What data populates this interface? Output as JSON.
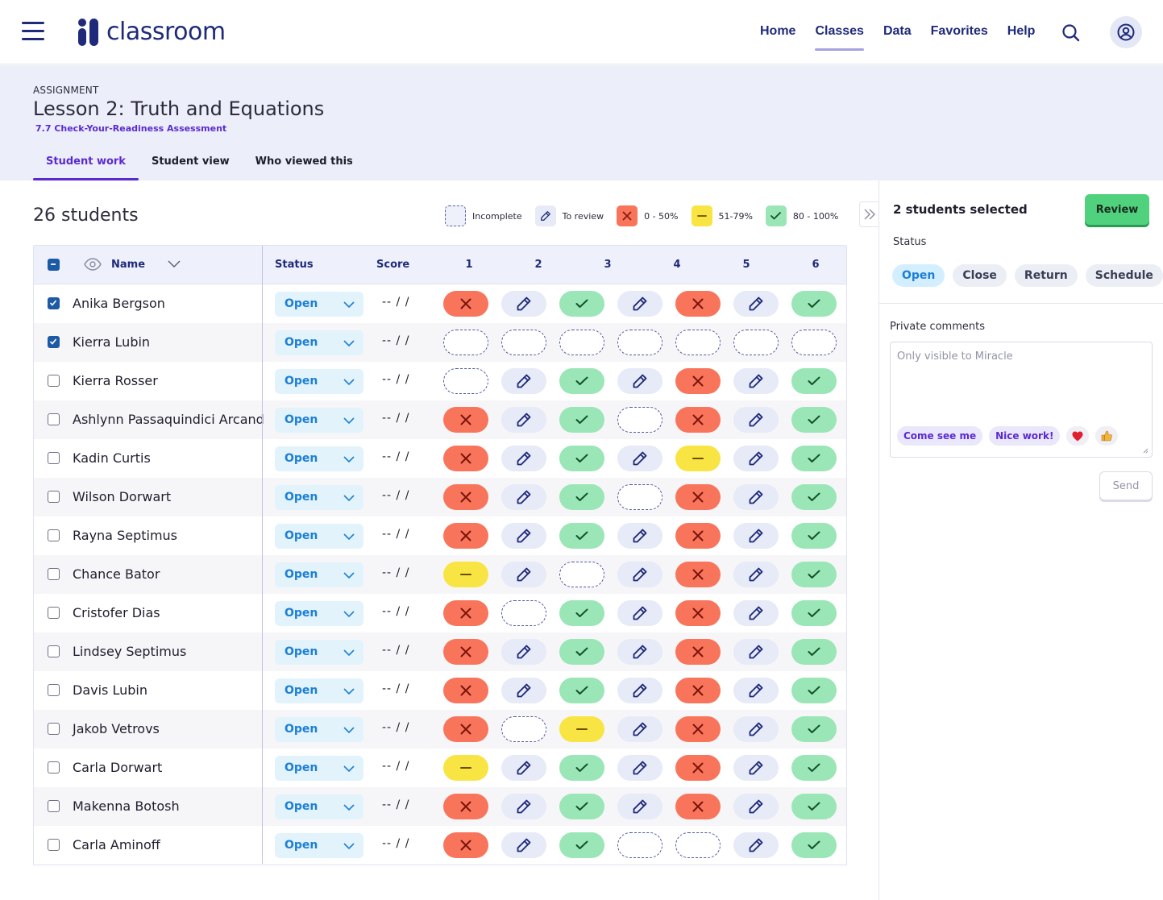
{
  "nav": {
    "brand": "classroom",
    "links": [
      "Home",
      "Classes",
      "Data",
      "Favorites",
      "Help"
    ],
    "active_link": "Classes"
  },
  "assignment": {
    "eyebrow": "ASSIGNMENT",
    "title": "Lesson 2: Truth and Equations",
    "subtitle": "7.7 Check-Your-Readiness Assessment",
    "tabs": [
      "Student work",
      "Student view",
      "Who viewed this"
    ],
    "active_tab": "Student work"
  },
  "summary": {
    "student_count": "26 students"
  },
  "legend": [
    {
      "key": "incomplete",
      "label": "Incomplete"
    },
    {
      "key": "review",
      "label": "To review"
    },
    {
      "key": "red",
      "label": "0 - 50%"
    },
    {
      "key": "yellow",
      "label": "51-79%"
    },
    {
      "key": "green",
      "label": "80 - 100%"
    }
  ],
  "colors": {
    "brand": "#1f2a7a",
    "accent": "#5a2ad1",
    "red": "#f8755c",
    "yellow": "#f8e543",
    "green": "#9ae6b6",
    "review": "#e7eaf7",
    "status_blue": "#1d7fd6"
  },
  "table": {
    "headers": {
      "name": "Name",
      "status": "Status",
      "score": "Score",
      "questions": [
        "1",
        "2",
        "3",
        "4",
        "5",
        "6"
      ]
    },
    "status_value": "Open",
    "score_text": "-- / /",
    "rows": [
      {
        "name": "Anika Bergson",
        "checked": true,
        "cells": [
          "red",
          "review",
          "green",
          "review",
          "red",
          "review",
          "green"
        ]
      },
      {
        "name": "Kierra Lubin",
        "checked": true,
        "cells": [
          "incomplete",
          "incomplete",
          "incomplete",
          "incomplete",
          "incomplete",
          "incomplete",
          "incomplete"
        ]
      },
      {
        "name": "Kierra Rosser",
        "checked": false,
        "cells": [
          "incomplete",
          "review",
          "green",
          "review",
          "red",
          "review",
          "green"
        ]
      },
      {
        "name": "Ashlynn Passaquindici Arcand",
        "checked": false,
        "cells": [
          "red",
          "review",
          "green",
          "incomplete",
          "red",
          "review",
          "green"
        ]
      },
      {
        "name": "Kadin Curtis",
        "checked": false,
        "cells": [
          "red",
          "review",
          "green",
          "review",
          "yellow",
          "review",
          "green"
        ]
      },
      {
        "name": "Wilson Dorwart",
        "checked": false,
        "cells": [
          "red",
          "review",
          "green",
          "incomplete",
          "red",
          "review",
          "green"
        ]
      },
      {
        "name": "Rayna Septimus",
        "checked": false,
        "cells": [
          "red",
          "review",
          "green",
          "review",
          "red",
          "review",
          "green"
        ]
      },
      {
        "name": "Chance Bator",
        "checked": false,
        "cells": [
          "yellow",
          "review",
          "incomplete",
          "review",
          "red",
          "review",
          "green"
        ]
      },
      {
        "name": "Cristofer Dias",
        "checked": false,
        "cells": [
          "red",
          "incomplete",
          "green",
          "review",
          "red",
          "review",
          "green"
        ]
      },
      {
        "name": "Lindsey Septimus",
        "checked": false,
        "cells": [
          "red",
          "review",
          "green",
          "review",
          "red",
          "review",
          "green"
        ]
      },
      {
        "name": "Davis Lubin",
        "checked": false,
        "cells": [
          "red",
          "review",
          "green",
          "review",
          "red",
          "review",
          "green"
        ]
      },
      {
        "name": "Jakob Vetrovs",
        "checked": false,
        "cells": [
          "red",
          "incomplete",
          "yellow",
          "review",
          "red",
          "review",
          "green"
        ]
      },
      {
        "name": "Carla Dorwart",
        "checked": false,
        "cells": [
          "yellow",
          "review",
          "green",
          "review",
          "red",
          "review",
          "green"
        ]
      },
      {
        "name": "Makenna Botosh",
        "checked": false,
        "cells": [
          "red",
          "review",
          "green",
          "review",
          "red",
          "review",
          "green"
        ]
      },
      {
        "name": "Carla Aminoff",
        "checked": false,
        "cells": [
          "red",
          "review",
          "green",
          "incomplete",
          "incomplete",
          "review",
          "green"
        ]
      }
    ]
  },
  "panel": {
    "selected_text": "2 students selected",
    "review_label": "Review",
    "status_label": "Status",
    "status_options": [
      "Open",
      "Close",
      "Return",
      "Schedule"
    ],
    "active_status": "Open",
    "comments_label": "Private comments",
    "comments_placeholder": "Only visible to Miracle",
    "quick_comments": [
      "Come see me",
      "Nice work!"
    ],
    "quick_emoji": [
      "heart-emoji",
      "thumbs-up-emoji"
    ],
    "send_label": "Send"
  }
}
